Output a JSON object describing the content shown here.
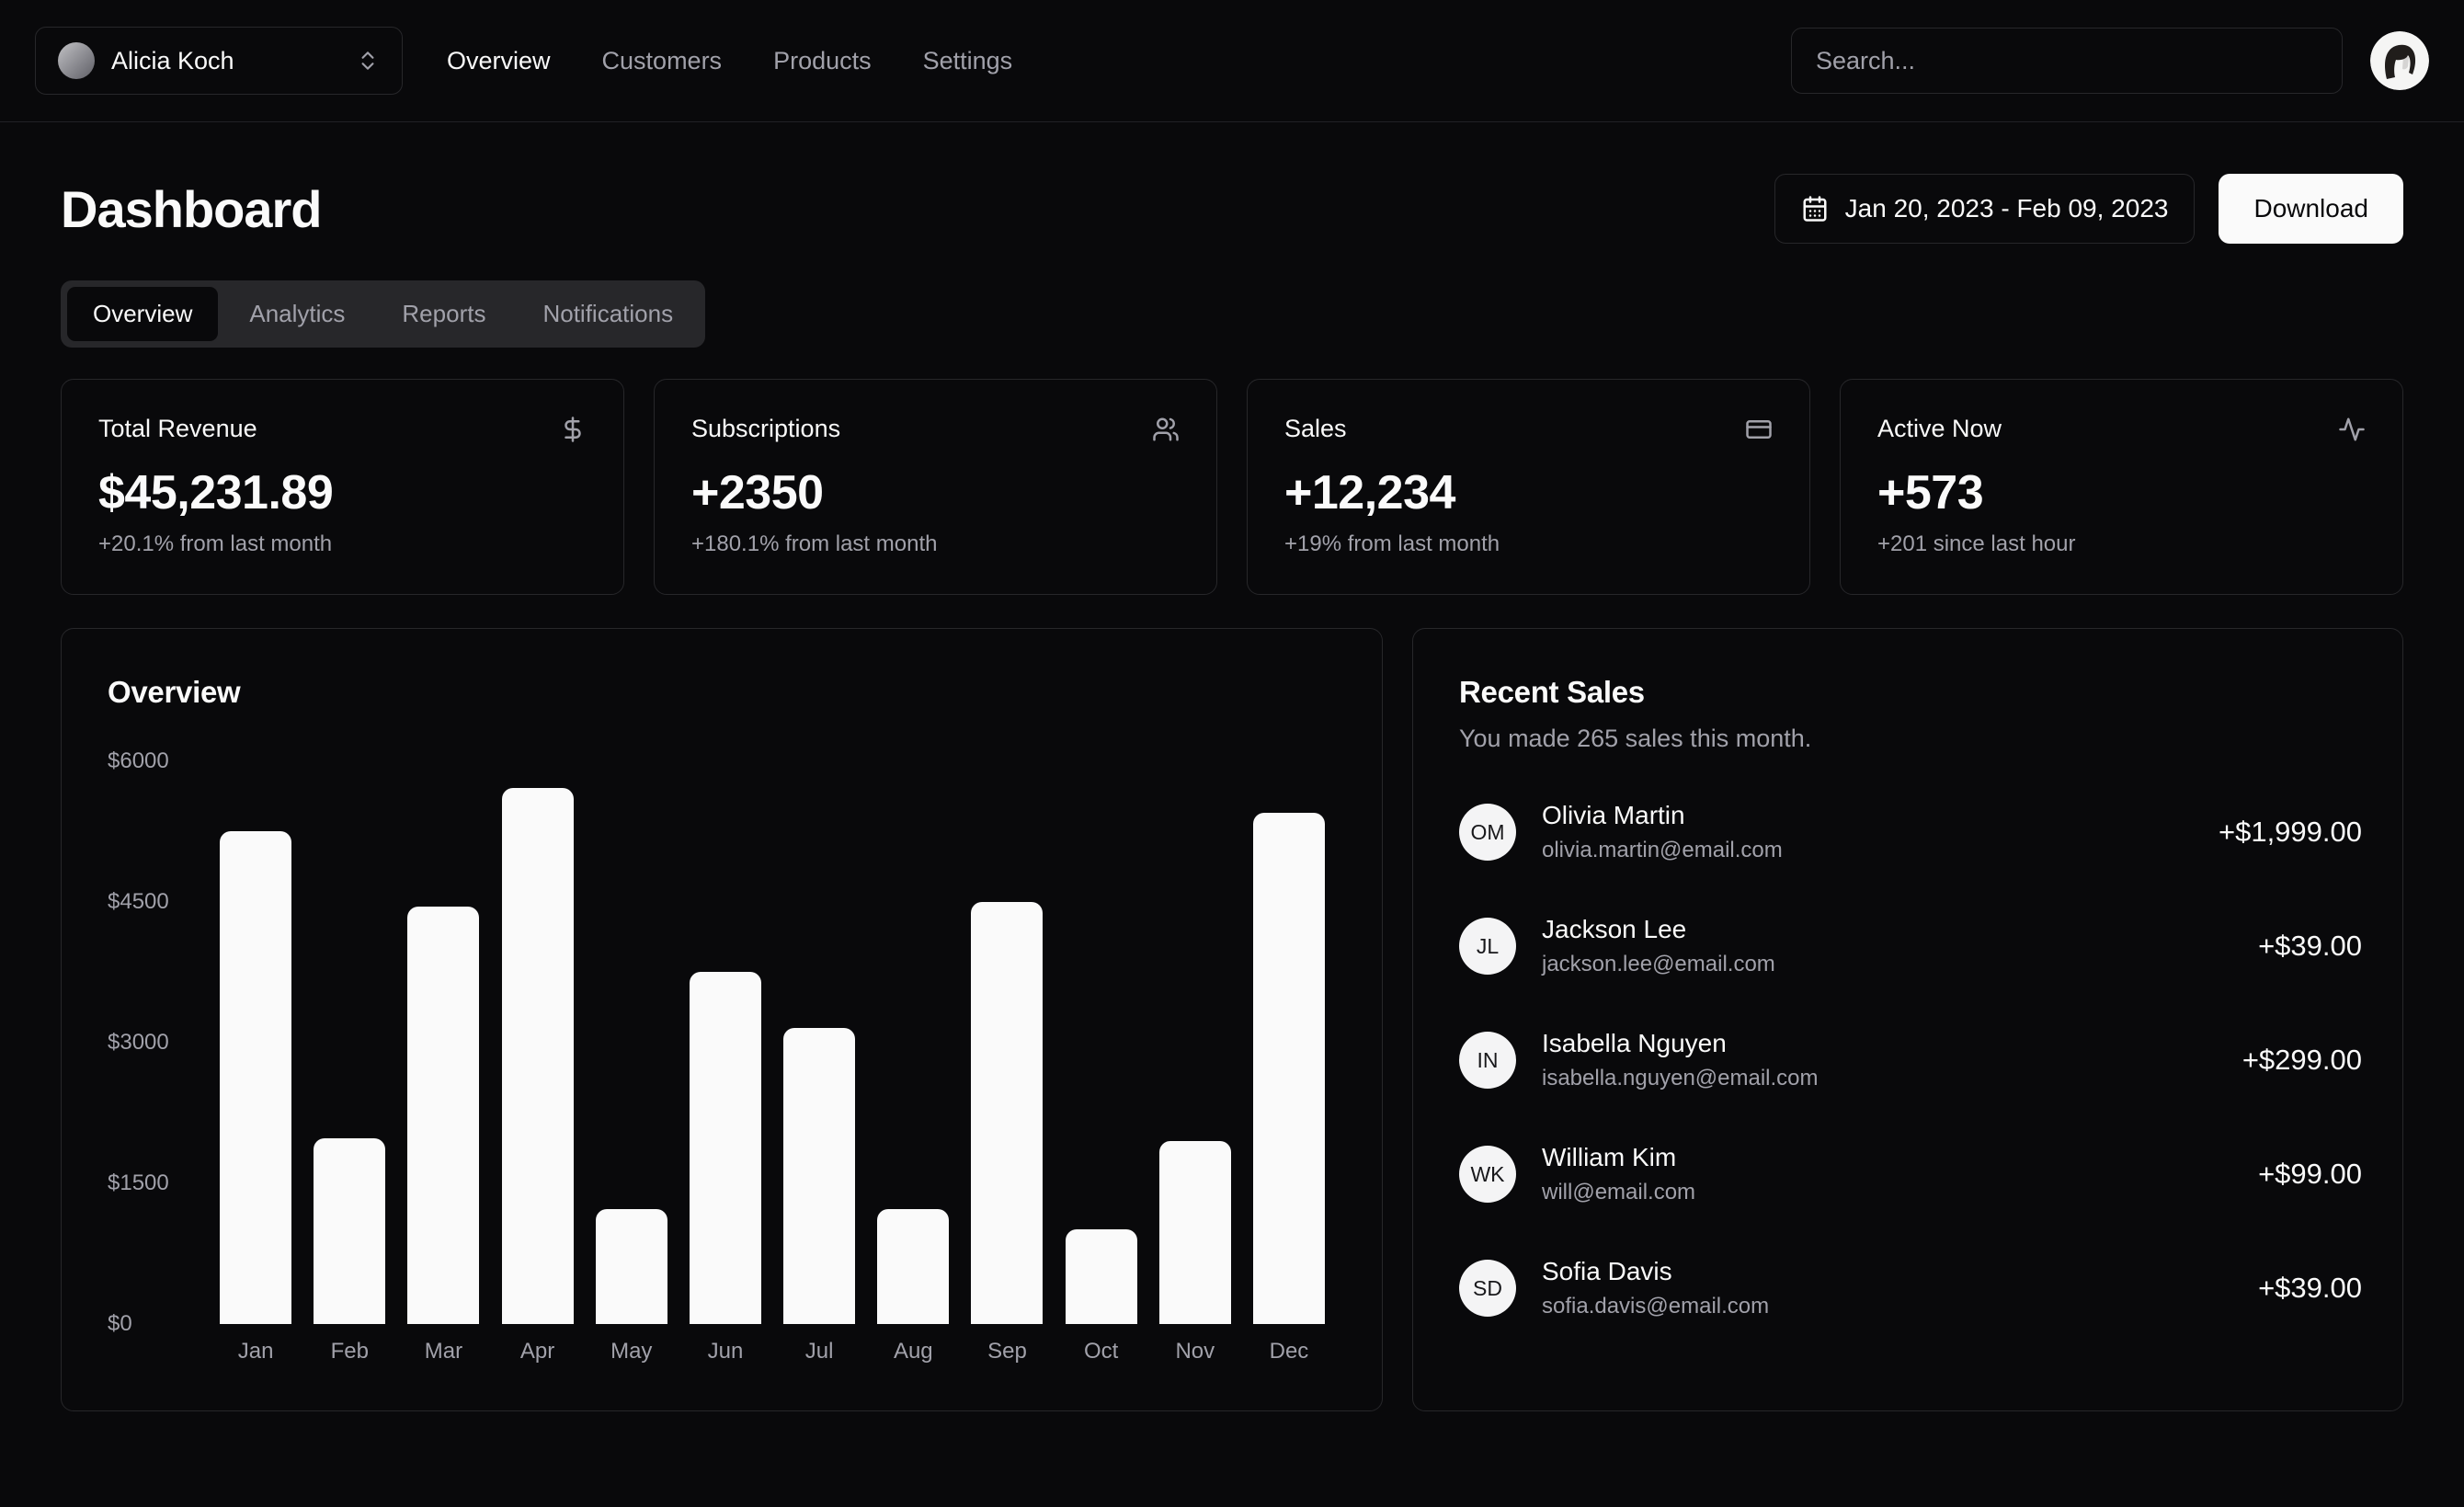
{
  "header": {
    "team_name": "Alicia Koch",
    "nav": [
      {
        "label": "Overview",
        "active": true
      },
      {
        "label": "Customers",
        "active": false
      },
      {
        "label": "Products",
        "active": false
      },
      {
        "label": "Settings",
        "active": false
      }
    ],
    "search_placeholder": "Search..."
  },
  "page": {
    "title": "Dashboard",
    "date_range": "Jan 20, 2023 - Feb 09, 2023",
    "download_label": "Download"
  },
  "tabs": [
    {
      "label": "Overview",
      "active": true
    },
    {
      "label": "Analytics",
      "active": false
    },
    {
      "label": "Reports",
      "active": false
    },
    {
      "label": "Notifications",
      "active": false
    }
  ],
  "stats": [
    {
      "title": "Total Revenue",
      "icon": "dollar-sign-icon",
      "value": "$45,231.89",
      "change": "+20.1% from last month"
    },
    {
      "title": "Subscriptions",
      "icon": "users-icon",
      "value": "+2350",
      "change": "+180.1% from last month"
    },
    {
      "title": "Sales",
      "icon": "credit-card-icon",
      "value": "+12,234",
      "change": "+19% from last month"
    },
    {
      "title": "Active Now",
      "icon": "activity-icon",
      "value": "+573",
      "change": "+201 since last hour"
    }
  ],
  "chart_data": {
    "type": "bar",
    "title": "Overview",
    "categories": [
      "Jan",
      "Feb",
      "Mar",
      "Apr",
      "May",
      "Jun",
      "Jul",
      "Aug",
      "Sep",
      "Oct",
      "Nov",
      "Dec"
    ],
    "values": [
      5255,
      1980,
      4450,
      5720,
      1225,
      3755,
      3155,
      1225,
      4500,
      1010,
      1950,
      5450
    ],
    "xlabel": "",
    "ylabel": "",
    "ylim": [
      0,
      6000
    ],
    "yticks": [
      6000,
      4500,
      3000,
      1500,
      0
    ],
    "ytick_labels": [
      "$6000",
      "$4500",
      "$3000",
      "$1500",
      "$0"
    ],
    "grid": false,
    "legend": false,
    "bar_color": "#fafafa"
  },
  "recent_sales": {
    "title": "Recent Sales",
    "subtitle": "You made 265 sales this month.",
    "items": [
      {
        "name": "Olivia Martin",
        "email": "olivia.martin@email.com",
        "amount": "+$1,999.00",
        "initials": "OM"
      },
      {
        "name": "Jackson Lee",
        "email": "jackson.lee@email.com",
        "amount": "+$39.00",
        "initials": "JL"
      },
      {
        "name": "Isabella Nguyen",
        "email": "isabella.nguyen@email.com",
        "amount": "+$299.00",
        "initials": "IN"
      },
      {
        "name": "William Kim",
        "email": "will@email.com",
        "amount": "+$99.00",
        "initials": "WK"
      },
      {
        "name": "Sofia Davis",
        "email": "sofia.davis@email.com",
        "amount": "+$39.00",
        "initials": "SD"
      }
    ]
  },
  "colors": {
    "background": "#09090b",
    "border": "#27272a",
    "foreground": "#fafafa",
    "muted": "#a1a1aa",
    "bar": "#fafafa"
  }
}
